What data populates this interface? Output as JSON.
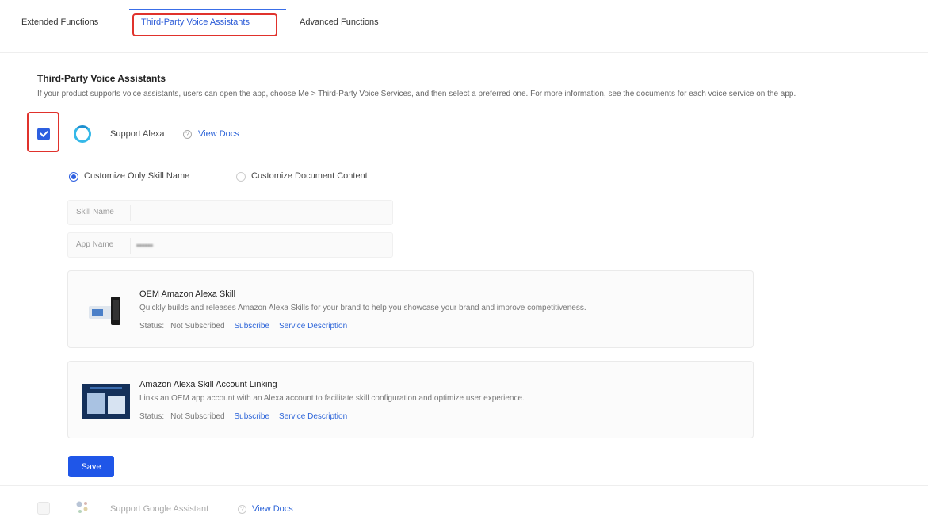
{
  "tabs": [
    {
      "label": "Extended Functions",
      "active": false
    },
    {
      "label": "Third-Party Voice Assistants",
      "active": true
    },
    {
      "label": "Advanced Functions",
      "active": false
    }
  ],
  "section": {
    "title": "Third-Party Voice Assistants",
    "description": "If your product supports voice assistants, users can open the app, choose Me > Third-Party Voice Services, and then select a preferred one. For more information, see the documents for each voice service on the app."
  },
  "alexa": {
    "checked": true,
    "label": "Support Alexa",
    "docs_link": "View Docs",
    "icon": "alexa-ring-icon",
    "options": [
      {
        "label": "Customize Only Skill Name",
        "selected": true
      },
      {
        "label": "Customize Document Content",
        "selected": false
      }
    ],
    "fields": [
      {
        "label": "Skill Name",
        "value": ""
      },
      {
        "label": "App Name",
        "value": "••••••"
      }
    ],
    "services": [
      {
        "title": "OEM Amazon Alexa Skill",
        "description": "Quickly builds and releases Amazon Alexa Skills for your brand to help you showcase your brand and improve competitiveness.",
        "status_label": "Status:",
        "status_value": "Not Subscribed",
        "subscribe_link": "Subscribe",
        "description_link": "Service Description"
      },
      {
        "title": "Amazon Alexa Skill Account Linking",
        "description": "Links an OEM app account with an Alexa account to facilitate skill configuration and optimize user experience.",
        "status_label": "Status:",
        "status_value": "Not Subscribed",
        "subscribe_link": "Subscribe",
        "description_link": "Service Description"
      }
    ],
    "save_label": "Save"
  },
  "google": {
    "checked": false,
    "label": "Support Google Assistant",
    "docs_link": "View Docs",
    "icon": "google-assistant-icon"
  },
  "colors": {
    "primary": "#1f56e8",
    "link": "#2b63d8",
    "highlight": "#e0322c"
  }
}
